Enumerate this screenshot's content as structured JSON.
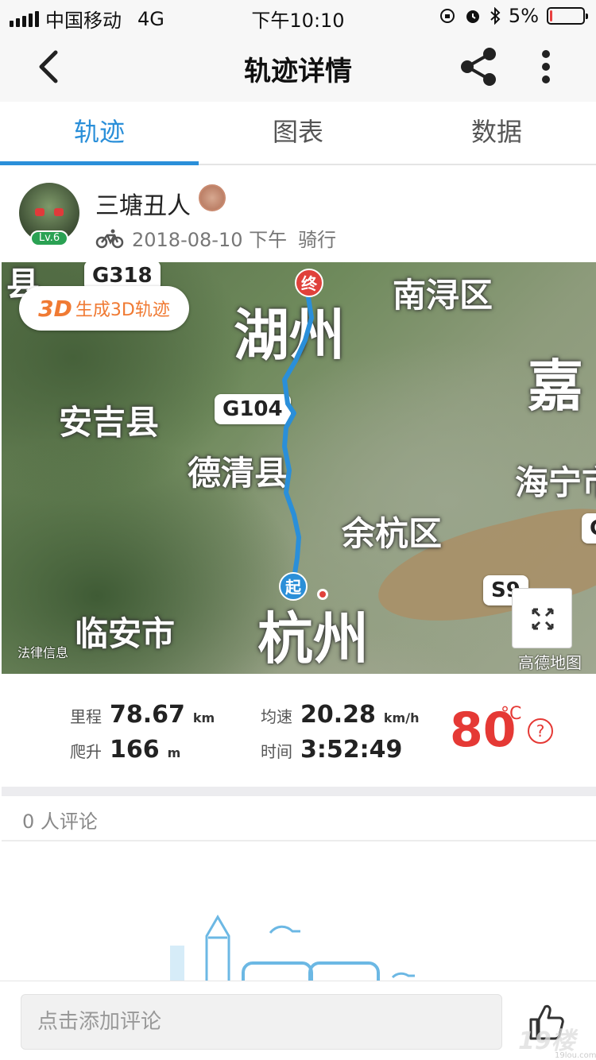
{
  "status_bar": {
    "carrier": "中国移动",
    "network": "4G",
    "time": "下午10:10",
    "battery": "5%",
    "battery_level": 0.05,
    "battery_color": "#e94040"
  },
  "nav": {
    "title": "轨迹详情",
    "back_icon": "chevron-left-icon",
    "share_icon": "share-icon",
    "more_icon": "more-vertical-icon"
  },
  "tabs": [
    {
      "label": "轨迹",
      "active": true
    },
    {
      "label": "图表",
      "active": false
    },
    {
      "label": "数据",
      "active": false
    }
  ],
  "accent_color": "#2a8fd9",
  "user": {
    "name": "三塘丑人",
    "level": "Lv.6",
    "date": "2018-08-10 下午",
    "activity": "骑行",
    "activity_icon": "bicycle-icon"
  },
  "map": {
    "button_3d_prefix": "3D",
    "button_3d_label": "生成3D轨迹",
    "end_marker": "终",
    "start_marker": "起",
    "brand": "高德地图",
    "legal": "法律信息",
    "labels": {
      "huzhou": "湖州",
      "hangzhou": "杭州",
      "anji": "安吉县",
      "deqing": "德清县",
      "linan": "临安市",
      "yuhang": "余杭区",
      "nanxun": "南浔区",
      "jia": "嘉",
      "haining": "海宁市",
      "xian_top": "县"
    },
    "roads": {
      "g318": "G318",
      "g104": "G104",
      "s9": "S9",
      "edge_g": "G"
    }
  },
  "stats": {
    "distance_label": "里程",
    "distance_value": "78.67",
    "distance_unit": "km",
    "climb_label": "爬升",
    "climb_value": "166",
    "climb_unit": "m",
    "speed_label": "均速",
    "speed_value": "20.28",
    "speed_unit": "km/h",
    "time_label": "时间",
    "time_value": "3:52:49",
    "temperature": "80",
    "temperature_unit": "°C",
    "help_icon": "question-circle-icon",
    "temperature_color": "#e53935"
  },
  "comments": {
    "count_text": "0 人评论",
    "input_placeholder": "点击添加评论",
    "like_icon": "thumbs-up-icon"
  },
  "watermark": {
    "text": "19楼",
    "sub": "19lou.com"
  }
}
